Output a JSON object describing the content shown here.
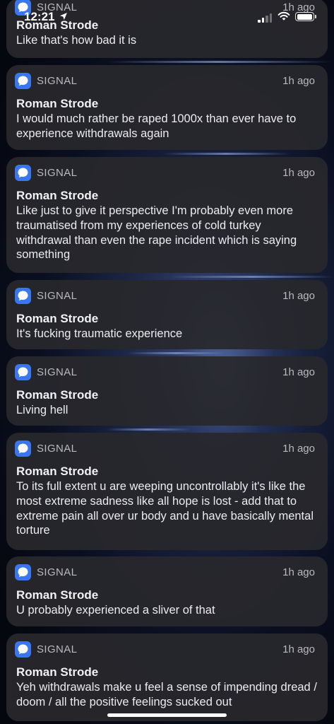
{
  "status_bar": {
    "time": "12:21",
    "cellular_bars_active": 2,
    "cellular_bars_total": 4,
    "battery_level": 1.0,
    "icons": [
      "location-arrow-icon",
      "cellular-signal-icon",
      "wifi-icon",
      "battery-icon"
    ]
  },
  "theme": {
    "card_background": "#28282c",
    "app_icon_color": "#3a76f0",
    "secondary_text": "#b9b9bf"
  },
  "notifications": [
    {
      "app": "SIGNAL",
      "time": "1h ago",
      "sender": "Roman Strode",
      "body": "Like that's how bad it is"
    },
    {
      "app": "SIGNAL",
      "time": "1h ago",
      "sender": "Roman Strode",
      "body": "I would much rather be raped 1000x than ever have to experience withdrawals again"
    },
    {
      "app": "SIGNAL",
      "time": "1h ago",
      "sender": "Roman Strode",
      "body": "Like just to give it perspective I'm probably even more traumatised from my experiences of cold turkey withdrawal than even the rape incident which is saying something"
    },
    {
      "app": "SIGNAL",
      "time": "1h ago",
      "sender": "Roman Strode",
      "body": "It's fucking traumatic experience"
    },
    {
      "app": "SIGNAL",
      "time": "1h ago",
      "sender": "Roman Strode",
      "body": "Living hell"
    },
    {
      "app": "SIGNAL",
      "time": "1h ago",
      "sender": "Roman Strode",
      "body": "To its full extent u are weeping uncontrollably it's like the most extreme sadness like all hope is lost - add that to extreme pain all over ur body and u have basically mental torture"
    },
    {
      "app": "SIGNAL",
      "time": "1h ago",
      "sender": "Roman Strode",
      "body": "U probably experienced a sliver of that"
    },
    {
      "app": "SIGNAL",
      "time": "1h ago",
      "sender": "Roman Strode",
      "body": "Yeh withdrawals make u feel a sense of impending dread / doom / all the positive feelings sucked out"
    }
  ]
}
